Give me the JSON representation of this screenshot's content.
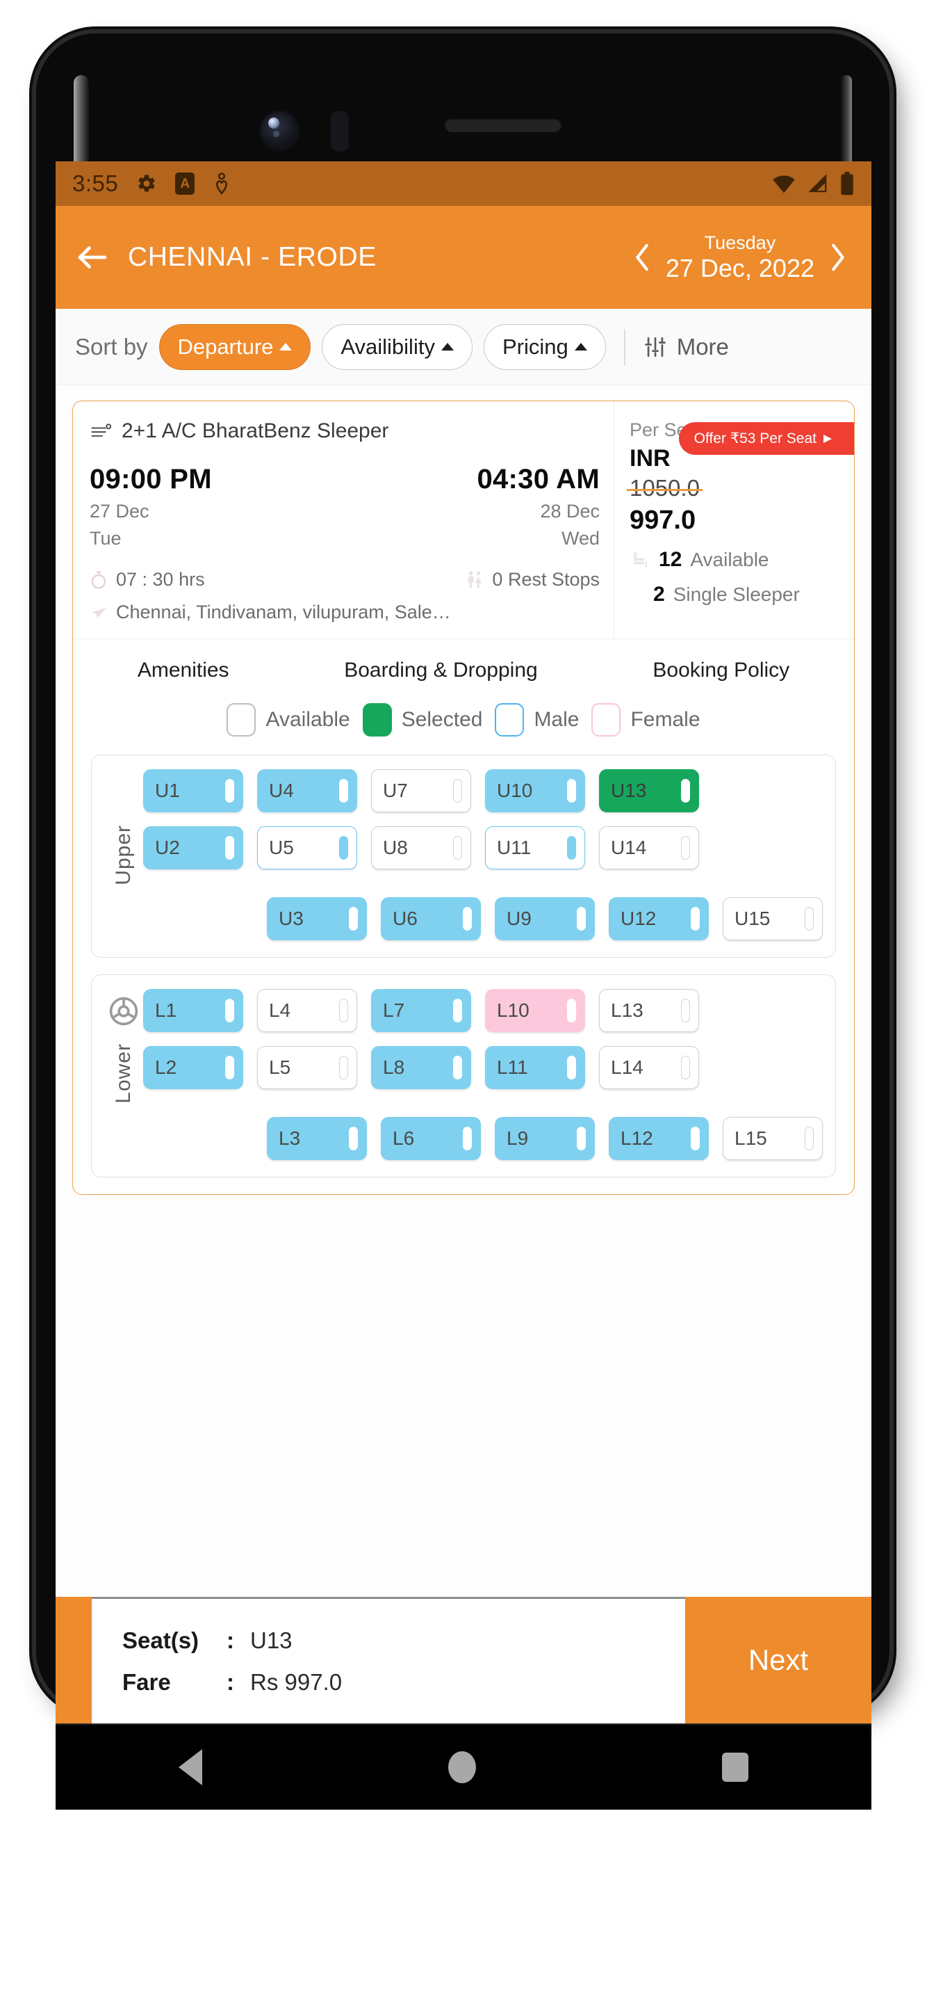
{
  "status_bar": {
    "time": "3:55",
    "left_icons": [
      "gear-icon",
      "a-badge-icon",
      "location-heart-icon"
    ],
    "right_icons": [
      "wifi-icon",
      "signal-icon",
      "battery-icon"
    ]
  },
  "app_bar": {
    "back_icon": "back-arrow-icon",
    "route_title": "CHENNAI - ERODE",
    "weekday": "Tuesday",
    "date": "27 Dec, 2022",
    "prev_icon": "chevron-left-icon",
    "next_icon": "chevron-right-icon"
  },
  "sort_bar": {
    "label": "Sort by",
    "chips": [
      {
        "label": "Departure",
        "active": true
      },
      {
        "label": "Availibility",
        "active": false
      },
      {
        "label": "Pricing",
        "active": false
      }
    ],
    "more_label": "More",
    "more_icon": "filter-sliders-icon"
  },
  "bus_card": {
    "bus_icon": "bus-icon",
    "bus_name": "2+1 A/C BharatBenz Sleeper",
    "offer_badge": "Offer ₹53 Per Seat",
    "departure": {
      "time": "09:00 PM",
      "date": "27 Dec",
      "day": "Tue"
    },
    "arrival": {
      "time": "04:30 AM",
      "date": "28 Dec",
      "day": "Wed"
    },
    "duration": "07 : 30 hrs",
    "rest_stops": "0 Rest Stops",
    "route": "Chennai, Tindivanam, vilupuram, Sale…",
    "per_seat_from": "Per Seat from",
    "currency": "INR",
    "original_price": "1050.0",
    "final_price": "997.0",
    "available_count": "12",
    "available_label": "Available",
    "single_count": "2",
    "single_label": "Single Sleeper",
    "accent_color": "#ee8b2d",
    "offer_color": "#ef3f33"
  },
  "tabs": [
    {
      "label": "Amenities"
    },
    {
      "label": "Boarding & Dropping"
    },
    {
      "label": "Booking Policy"
    }
  ],
  "legend": [
    {
      "label": "Available",
      "state": "available",
      "color": "#ffffff"
    },
    {
      "label": "Selected",
      "state": "selected",
      "color": "#16a75c"
    },
    {
      "label": "Male",
      "state": "male",
      "color": "#4fb3f0"
    },
    {
      "label": "Female",
      "state": "female",
      "color": "#f9c6d6"
    }
  ],
  "decks": [
    {
      "name": "Upper",
      "icon": null,
      "rows": [
        [
          {
            "id": "U1",
            "state": "male"
          },
          {
            "id": "U4",
            "state": "male"
          },
          {
            "id": "U7",
            "state": "available"
          },
          {
            "id": "U10",
            "state": "male"
          },
          {
            "id": "U13",
            "state": "selected"
          }
        ],
        [
          {
            "id": "U2",
            "state": "male"
          },
          {
            "id": "U5",
            "state": "male-outline"
          },
          {
            "id": "U8",
            "state": "available"
          },
          {
            "id": "U11",
            "state": "male-outline"
          },
          {
            "id": "U14",
            "state": "available"
          }
        ],
        [
          {
            "id": "U3",
            "state": "male"
          },
          {
            "id": "U6",
            "state": "male"
          },
          {
            "id": "U9",
            "state": "male"
          },
          {
            "id": "U12",
            "state": "male"
          },
          {
            "id": "U15",
            "state": "available"
          }
        ]
      ]
    },
    {
      "name": "Lower",
      "icon": "steering-wheel-icon",
      "rows": [
        [
          {
            "id": "L1",
            "state": "male"
          },
          {
            "id": "L4",
            "state": "available"
          },
          {
            "id": "L7",
            "state": "male"
          },
          {
            "id": "L10",
            "state": "female"
          },
          {
            "id": "L13",
            "state": "available"
          }
        ],
        [
          {
            "id": "L2",
            "state": "male"
          },
          {
            "id": "L5",
            "state": "available"
          },
          {
            "id": "L8",
            "state": "male"
          },
          {
            "id": "L11",
            "state": "male"
          },
          {
            "id": "L14",
            "state": "available"
          }
        ],
        [
          {
            "id": "L3",
            "state": "male"
          },
          {
            "id": "L6",
            "state": "male"
          },
          {
            "id": "L9",
            "state": "male"
          },
          {
            "id": "L12",
            "state": "male"
          },
          {
            "id": "L15",
            "state": "available"
          }
        ]
      ]
    }
  ],
  "bottom_bar": {
    "seats_key": "Seat(s)",
    "seats_colon": ":",
    "seats_value": "U13",
    "fare_key": "Fare",
    "fare_colon": ":",
    "fare_value": "Rs 997.0",
    "next_label": "Next"
  },
  "nav_bar": {
    "back_icon": "triangle-back-icon",
    "home_icon": "circle-home-icon",
    "recents_icon": "square-recents-icon"
  }
}
